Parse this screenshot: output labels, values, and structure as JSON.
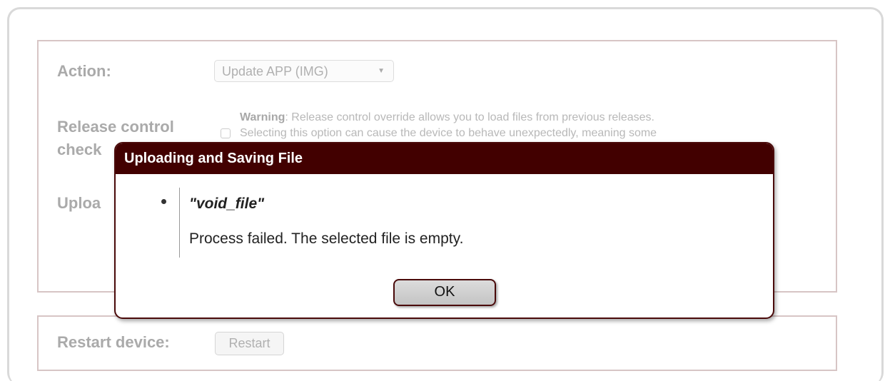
{
  "form": {
    "action_label": "Action:",
    "action_value": "Update APP (IMG)",
    "release_label_line1": "Release control",
    "release_label_line2": "check",
    "warning_bold": "Warning",
    "warning_line1_rest": ": Release control override allows you to load files from previous releases.",
    "warning_line2": "Selecting this option can cause the device to behave unexpectedly, meaning some",
    "upload_label": "Uploa",
    "restart_label": "Restart device:",
    "restart_button": "Restart"
  },
  "dialog": {
    "title": "Uploading and Saving File",
    "file_name": "\"void_file\"",
    "message": "Process failed. The selected file is empty.",
    "ok_button": "OK"
  },
  "colors": {
    "dialog_header": "#420000",
    "dialog_border": "#4a0a0a",
    "panel_border": "#d7c5c5"
  },
  "icons": {
    "select_arrow": "chevron-down-icon"
  }
}
